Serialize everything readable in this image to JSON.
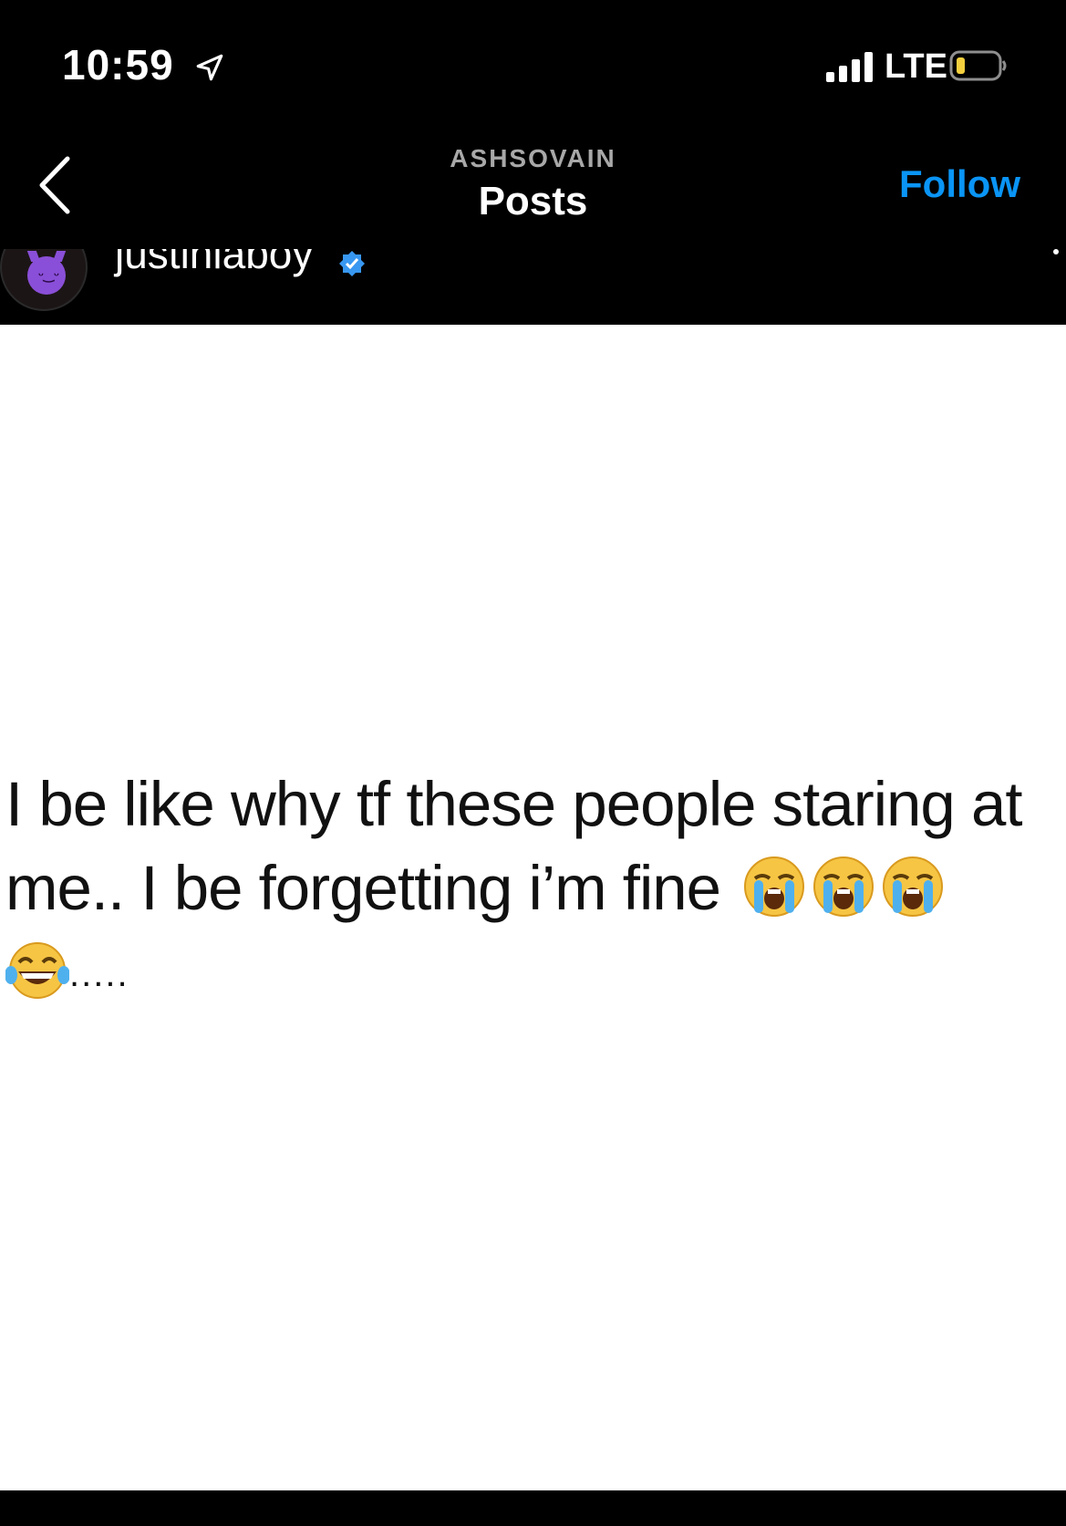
{
  "status_bar": {
    "time": "10:59",
    "network": "LTE",
    "icons": [
      "location-arrow-icon",
      "signal-icon",
      "battery-icon"
    ],
    "battery_color": "#f4d03f"
  },
  "nav": {
    "username": "ASHSOVAIN",
    "title": "Posts",
    "follow_label": "Follow",
    "follow_color": "#0a95f6",
    "icons": [
      "back-chevron-icon"
    ]
  },
  "post": {
    "author_handle": "justinlaboy",
    "avatar_emoji": "smiling-imp-emoji",
    "verified_icon": "verified-badge-icon",
    "caption_line1": "I be like why tf these people staring at",
    "caption_line2": "me.. I be forgetting i’m fine",
    "caption_line3_trailing": ".....",
    "caption_emojis_line2": [
      "loudly-crying-emoji",
      "loudly-crying-emoji",
      "loudly-crying-emoji"
    ],
    "caption_emojis_line3": [
      "tears-of-joy-emoji"
    ]
  }
}
